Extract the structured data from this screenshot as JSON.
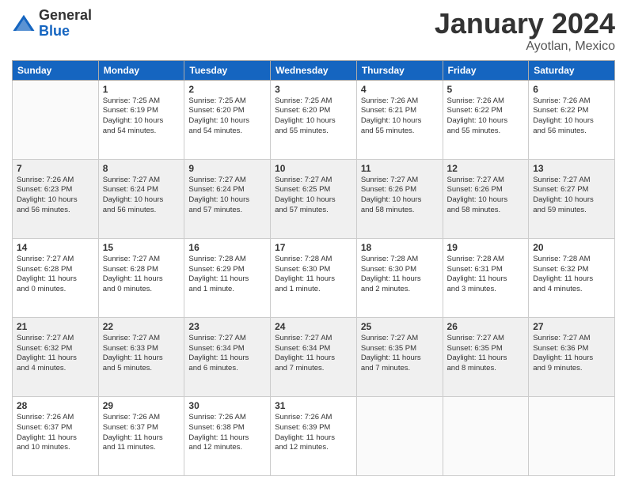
{
  "header": {
    "logo_general": "General",
    "logo_blue": "Blue",
    "month_title": "January 2024",
    "location": "Ayotlan, Mexico"
  },
  "weekdays": [
    "Sunday",
    "Monday",
    "Tuesday",
    "Wednesday",
    "Thursday",
    "Friday",
    "Saturday"
  ],
  "weeks": [
    [
      {
        "day": "",
        "info": ""
      },
      {
        "day": "1",
        "info": "Sunrise: 7:25 AM\nSunset: 6:19 PM\nDaylight: 10 hours\nand 54 minutes."
      },
      {
        "day": "2",
        "info": "Sunrise: 7:25 AM\nSunset: 6:20 PM\nDaylight: 10 hours\nand 54 minutes."
      },
      {
        "day": "3",
        "info": "Sunrise: 7:25 AM\nSunset: 6:20 PM\nDaylight: 10 hours\nand 55 minutes."
      },
      {
        "day": "4",
        "info": "Sunrise: 7:26 AM\nSunset: 6:21 PM\nDaylight: 10 hours\nand 55 minutes."
      },
      {
        "day": "5",
        "info": "Sunrise: 7:26 AM\nSunset: 6:22 PM\nDaylight: 10 hours\nand 55 minutes."
      },
      {
        "day": "6",
        "info": "Sunrise: 7:26 AM\nSunset: 6:22 PM\nDaylight: 10 hours\nand 56 minutes."
      }
    ],
    [
      {
        "day": "7",
        "info": "Sunrise: 7:26 AM\nSunset: 6:23 PM\nDaylight: 10 hours\nand 56 minutes."
      },
      {
        "day": "8",
        "info": "Sunrise: 7:27 AM\nSunset: 6:24 PM\nDaylight: 10 hours\nand 56 minutes."
      },
      {
        "day": "9",
        "info": "Sunrise: 7:27 AM\nSunset: 6:24 PM\nDaylight: 10 hours\nand 57 minutes."
      },
      {
        "day": "10",
        "info": "Sunrise: 7:27 AM\nSunset: 6:25 PM\nDaylight: 10 hours\nand 57 minutes."
      },
      {
        "day": "11",
        "info": "Sunrise: 7:27 AM\nSunset: 6:26 PM\nDaylight: 10 hours\nand 58 minutes."
      },
      {
        "day": "12",
        "info": "Sunrise: 7:27 AM\nSunset: 6:26 PM\nDaylight: 10 hours\nand 58 minutes."
      },
      {
        "day": "13",
        "info": "Sunrise: 7:27 AM\nSunset: 6:27 PM\nDaylight: 10 hours\nand 59 minutes."
      }
    ],
    [
      {
        "day": "14",
        "info": "Sunrise: 7:27 AM\nSunset: 6:28 PM\nDaylight: 11 hours\nand 0 minutes."
      },
      {
        "day": "15",
        "info": "Sunrise: 7:27 AM\nSunset: 6:28 PM\nDaylight: 11 hours\nand 0 minutes."
      },
      {
        "day": "16",
        "info": "Sunrise: 7:28 AM\nSunset: 6:29 PM\nDaylight: 11 hours\nand 1 minute."
      },
      {
        "day": "17",
        "info": "Sunrise: 7:28 AM\nSunset: 6:30 PM\nDaylight: 11 hours\nand 1 minute."
      },
      {
        "day": "18",
        "info": "Sunrise: 7:28 AM\nSunset: 6:30 PM\nDaylight: 11 hours\nand 2 minutes."
      },
      {
        "day": "19",
        "info": "Sunrise: 7:28 AM\nSunset: 6:31 PM\nDaylight: 11 hours\nand 3 minutes."
      },
      {
        "day": "20",
        "info": "Sunrise: 7:28 AM\nSunset: 6:32 PM\nDaylight: 11 hours\nand 4 minutes."
      }
    ],
    [
      {
        "day": "21",
        "info": "Sunrise: 7:27 AM\nSunset: 6:32 PM\nDaylight: 11 hours\nand 4 minutes."
      },
      {
        "day": "22",
        "info": "Sunrise: 7:27 AM\nSunset: 6:33 PM\nDaylight: 11 hours\nand 5 minutes."
      },
      {
        "day": "23",
        "info": "Sunrise: 7:27 AM\nSunset: 6:34 PM\nDaylight: 11 hours\nand 6 minutes."
      },
      {
        "day": "24",
        "info": "Sunrise: 7:27 AM\nSunset: 6:34 PM\nDaylight: 11 hours\nand 7 minutes."
      },
      {
        "day": "25",
        "info": "Sunrise: 7:27 AM\nSunset: 6:35 PM\nDaylight: 11 hours\nand 7 minutes."
      },
      {
        "day": "26",
        "info": "Sunrise: 7:27 AM\nSunset: 6:35 PM\nDaylight: 11 hours\nand 8 minutes."
      },
      {
        "day": "27",
        "info": "Sunrise: 7:27 AM\nSunset: 6:36 PM\nDaylight: 11 hours\nand 9 minutes."
      }
    ],
    [
      {
        "day": "28",
        "info": "Sunrise: 7:26 AM\nSunset: 6:37 PM\nDaylight: 11 hours\nand 10 minutes."
      },
      {
        "day": "29",
        "info": "Sunrise: 7:26 AM\nSunset: 6:37 PM\nDaylight: 11 hours\nand 11 minutes."
      },
      {
        "day": "30",
        "info": "Sunrise: 7:26 AM\nSunset: 6:38 PM\nDaylight: 11 hours\nand 12 minutes."
      },
      {
        "day": "31",
        "info": "Sunrise: 7:26 AM\nSunset: 6:39 PM\nDaylight: 11 hours\nand 12 minutes."
      },
      {
        "day": "",
        "info": ""
      },
      {
        "day": "",
        "info": ""
      },
      {
        "day": "",
        "info": ""
      }
    ]
  ]
}
